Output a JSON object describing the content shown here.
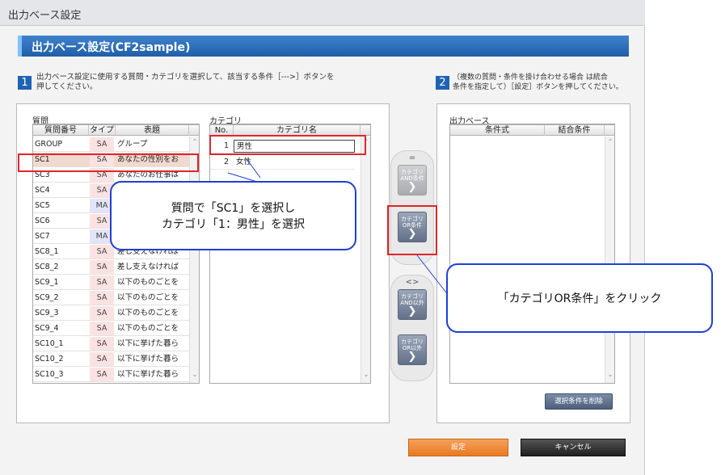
{
  "dialog": {
    "title": "出力ベース設定"
  },
  "heading": "出力ベース設定(CF2sample)",
  "steps": {
    "step1": {
      "num": "1",
      "text": "出力ベース設定に使用する質問・カテゴリを選択して、該当する条件［--->］ボタンを\n押してください。"
    },
    "step2": {
      "num": "2",
      "text": "（複数の質問・条件を掛け合わせる場合 は統合\n条件を指定して）［設定］ボタンを押してください。"
    }
  },
  "question_panel": {
    "label": "質問",
    "headers": {
      "num": "質問番号",
      "type": "タイプ",
      "title": "表題"
    },
    "rows": [
      {
        "num": "GROUP",
        "type": "SA",
        "title": "グループ"
      },
      {
        "num": "SC1",
        "type": "SA",
        "title": "あなたの性別をお"
      },
      {
        "num": "SC3",
        "type": "SA",
        "title": "あなたのお仕事は"
      },
      {
        "num": "SC4",
        "type": "SA",
        "title": ""
      },
      {
        "num": "SC5",
        "type": "MA",
        "title": ""
      },
      {
        "num": "SC6",
        "type": "SA",
        "title": ""
      },
      {
        "num": "SC7",
        "type": "MA",
        "title": ""
      },
      {
        "num": "SC8_1",
        "type": "SA",
        "title": "差し支えなければ"
      },
      {
        "num": "SC8_2",
        "type": "SA",
        "title": "差し支えなければ"
      },
      {
        "num": "SC9_1",
        "type": "SA",
        "title": "以下のものごとを"
      },
      {
        "num": "SC9_2",
        "type": "SA",
        "title": "以下のものごとを"
      },
      {
        "num": "SC9_3",
        "type": "SA",
        "title": "以下のものごとを"
      },
      {
        "num": "SC9_4",
        "type": "SA",
        "title": "以下のものごとを"
      },
      {
        "num": "SC10_1",
        "type": "SA",
        "title": "以下に挙げた暮ら"
      },
      {
        "num": "SC10_2",
        "type": "SA",
        "title": "以下に挙げた暮ら"
      },
      {
        "num": "SC10_3",
        "type": "SA",
        "title": "以下に挙げた暮ら"
      }
    ]
  },
  "category_panel": {
    "label": "カテゴリ",
    "headers": {
      "no": "No.",
      "name": "カテゴリ名"
    },
    "rows": [
      {
        "no": "1",
        "name": "男性"
      },
      {
        "no": "2",
        "name": "女性"
      }
    ]
  },
  "condition_buttons": {
    "eq_symbol": "=",
    "ne_symbol": "<>",
    "and_cond": {
      "label": "カテゴリ\nAND条件",
      "chevron": "❯"
    },
    "or_cond": {
      "label": "カテゴリ\nOR条件",
      "chevron": "❯"
    },
    "and_not": {
      "label": "カテゴリ\nAND以外",
      "chevron": "❯"
    },
    "or_not": {
      "label": "カテゴリ\nOR以外",
      "chevron": "❯"
    }
  },
  "output_panel": {
    "label": "出力ベース",
    "headers": {
      "expr": "条件式",
      "combine": "結合条件"
    },
    "delete_button": "選択条件を削除"
  },
  "footer": {
    "ok_button": "設定",
    "cancel_button": "キャンセル"
  },
  "callouts": {
    "select": "質問で「SC1」を選択し\nカテゴリ「1：男性」を選択",
    "click": "「カテゴリOR条件」をクリック"
  },
  "colors": {
    "accent": "#1e63b4",
    "annotation_red": "#e0262a",
    "callout_blue": "#1f3fd6",
    "primary_orange": "#e97a22"
  }
}
